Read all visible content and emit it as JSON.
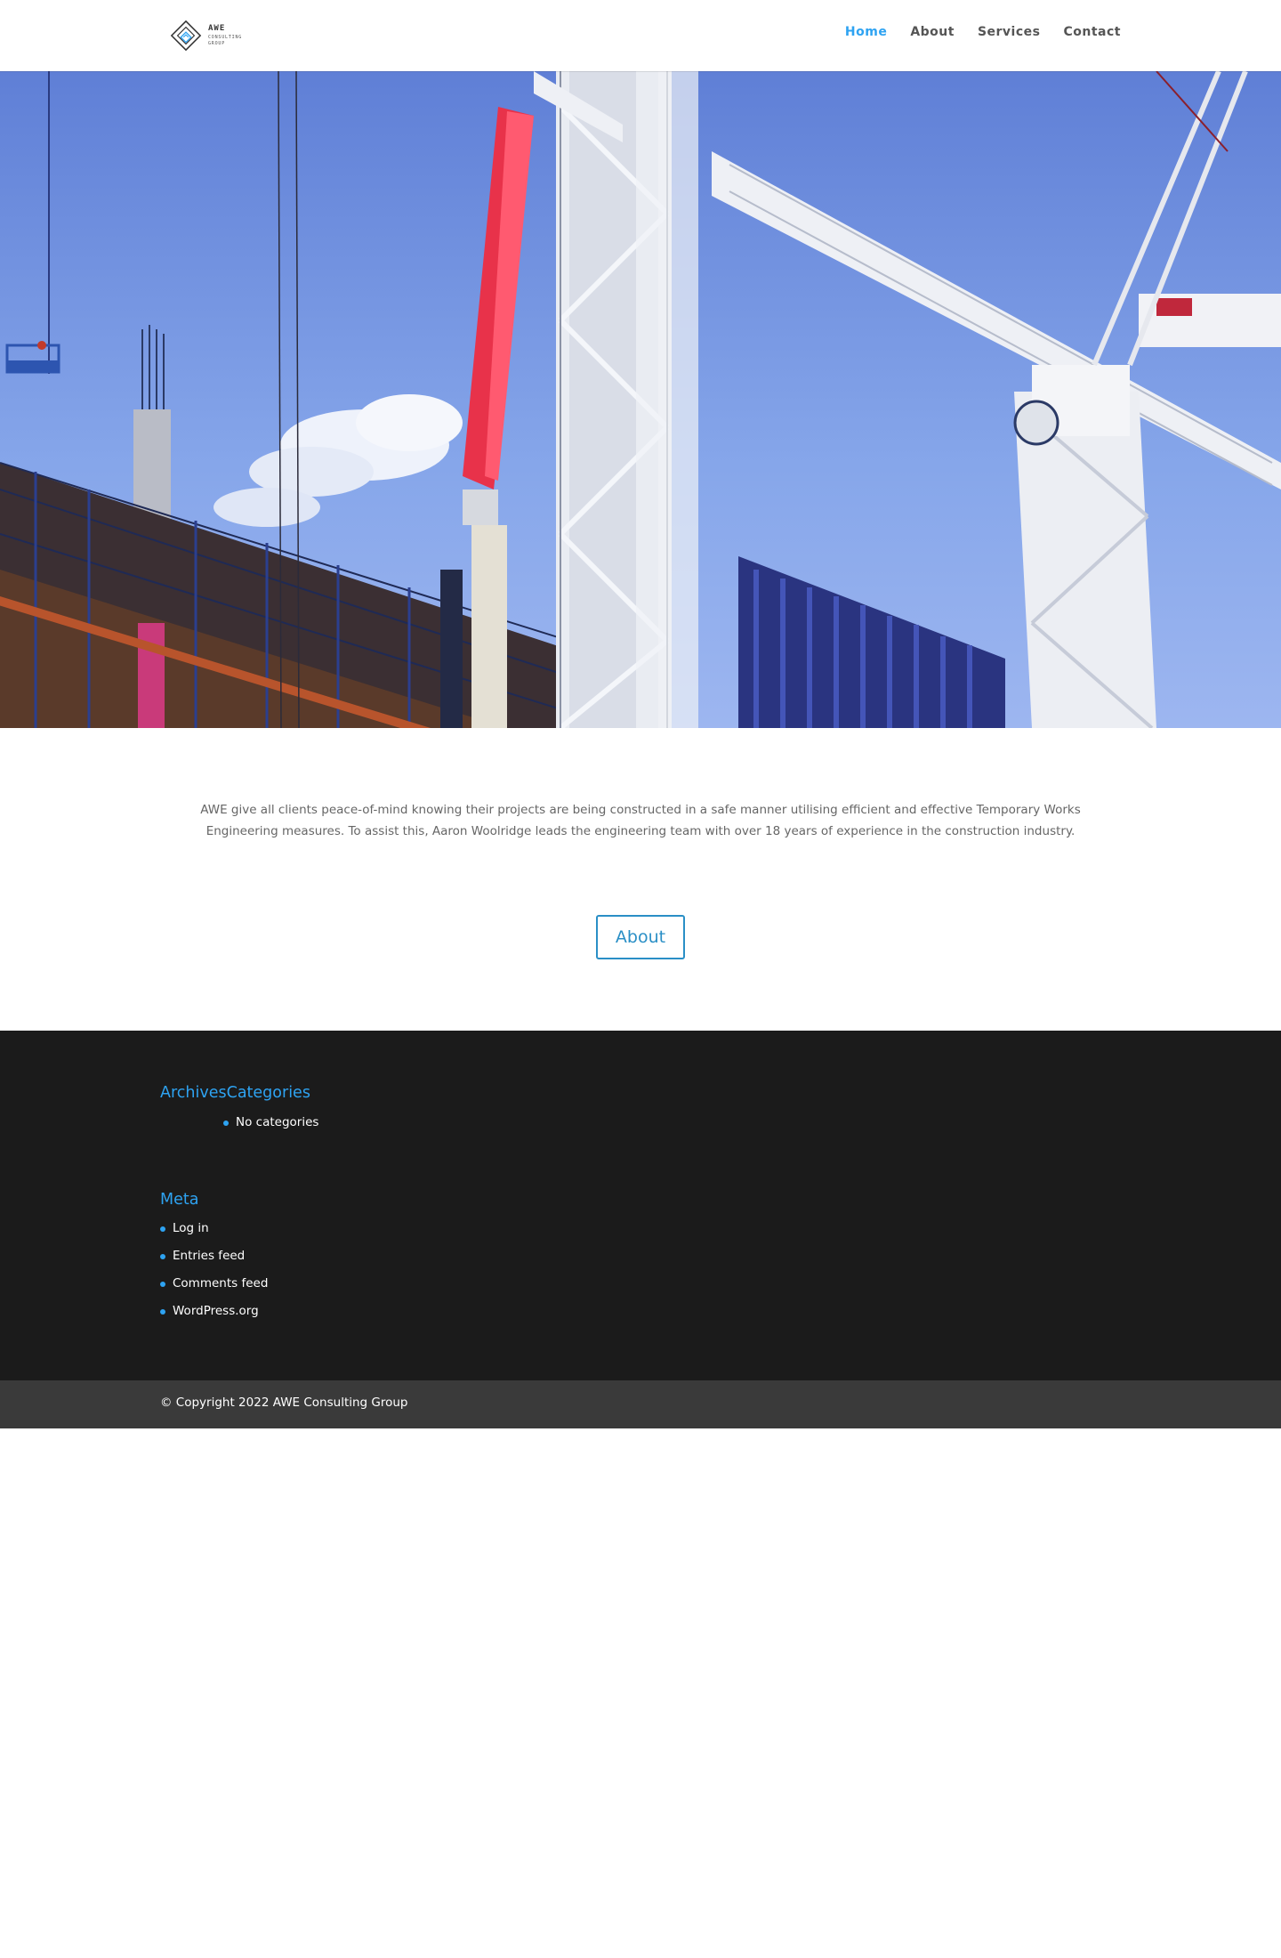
{
  "header": {
    "logo": {
      "title": "AWE",
      "subtitle_line1": "CONSULTING",
      "subtitle_line2": "GROUP",
      "icon": "diamond-logo-icon"
    },
    "nav": [
      {
        "label": "Home",
        "active": true
      },
      {
        "label": "About",
        "active": false
      },
      {
        "label": "Services",
        "active": false
      },
      {
        "label": "Contact",
        "active": false
      }
    ]
  },
  "hero": {
    "image": "construction-cranes-photo",
    "colors": {
      "sky": "#7a9be0",
      "crane": "#f2f2f2",
      "boom": "#e8324a",
      "building": "#3a2e2a"
    }
  },
  "intro": {
    "text": "AWE give all clients peace-of-mind knowing their projects are being constructed in a safe manner utilising efficient and effective Temporary Works Engineering measures.  To assist this, Aaron Woolridge leads the engineering team with over 18 years of experience in the construction industry.",
    "button_label": "About"
  },
  "footer": {
    "archives_title": "Archives",
    "categories_title": "Categories",
    "categories_items": [
      "No categories"
    ],
    "meta_title": "Meta",
    "meta_items": [
      "Log in",
      "Entries feed",
      "Comments feed",
      "WordPress.org"
    ],
    "copyright": "© Copyright 2022 AWE Consulting Group"
  },
  "colors": {
    "accent": "#2ea3f2",
    "button": "#2a8fc6",
    "footer_bg": "#1b1b1b",
    "bottom_bar_bg": "#3a3a3a"
  }
}
